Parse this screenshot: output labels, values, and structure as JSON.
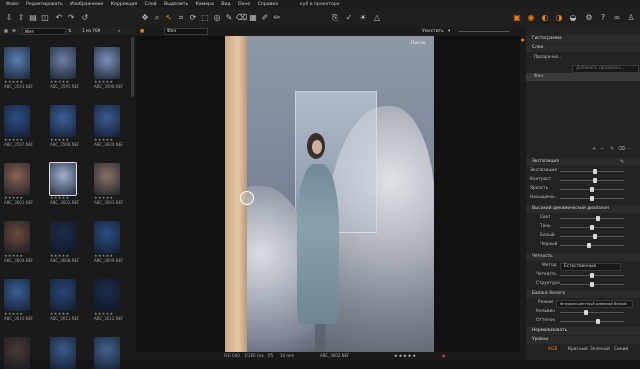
{
  "menubar": {
    "items": [
      "Файл",
      "Редактировать",
      "Изображение",
      "Коррекция",
      "Слой",
      "Выделить",
      "Камера",
      "Вид",
      "Окно",
      "Справка"
    ],
    "app_title": "ку6 в проекторе"
  },
  "browser": {
    "sort_label": "Имя",
    "count_label": "1 из 709",
    "thumbnails": [
      {
        "name": "ABC_3593.NEF",
        "stars": "★★★★★",
        "color": "#5a7fb0",
        "selected": false
      },
      {
        "name": "ABC_3595.NEF",
        "stars": "★★★★★",
        "color": "#6d80a8",
        "selected": false
      },
      {
        "name": "ABC_3596.NEF",
        "stars": "★★★★★",
        "color": "#7a8fb8",
        "selected": false
      },
      {
        "name": "ABC_3597.NEF",
        "stars": "★★★★★",
        "color": "#2e4e86",
        "selected": false
      },
      {
        "name": "ABC_3598.NEF",
        "stars": "★★★★★",
        "color": "#3c5f99",
        "selected": false
      },
      {
        "name": "ABC_3600.NEF",
        "stars": "★★★★★",
        "color": "#3a5a92",
        "selected": false
      },
      {
        "name": "ABC_3601.NEF",
        "stars": "★★★★★",
        "color": "#8a6450",
        "selected": false
      },
      {
        "name": "ABC_3602.NEF",
        "stars": "★★★★★",
        "color": "#9fb2cf",
        "selected": true
      },
      {
        "name": "ABC_3603.NEF",
        "stars": "★★★★★",
        "color": "#8a7266",
        "selected": false
      },
      {
        "name": "ABC_3604.NEF",
        "stars": "★★★★★",
        "color": "#6a4a3c",
        "selected": false
      },
      {
        "name": "ABC_3608.NEF",
        "stars": "★★★★★",
        "color": "#1e2c4a",
        "selected": false
      },
      {
        "name": "ABC_3609.NEF",
        "stars": "★★★★★",
        "color": "#2a4f84",
        "selected": false
      },
      {
        "name": "ABC_3610.NEF",
        "stars": "★★★★★",
        "color": "#3a5f94",
        "selected": false
      },
      {
        "name": "ABC_3611.NEF",
        "stars": "★★★★★",
        "color": "#2a4676",
        "selected": false
      },
      {
        "name": "ABC_3612.NEF",
        "stars": "★★★★★",
        "color": "#1c2c4c",
        "selected": false
      },
      {
        "name": "",
        "stars": "",
        "color": "#4a3a34",
        "selected": false
      },
      {
        "name": "",
        "stars": "",
        "color": "#3c5b8a",
        "selected": false
      },
      {
        "name": "",
        "stars": "",
        "color": "#43638f",
        "selected": false
      }
    ]
  },
  "viewer": {
    "header_label": "Фон",
    "zoom_label": "Уместить",
    "after_label": "После",
    "footer": {
      "iso": "ISO 640",
      "shutter": "1/160 сек",
      "aperture": "f/5",
      "focal": "34 mm",
      "filename": "ABC_3602.NEF",
      "stars": "★★★★★"
    }
  },
  "panel": {
    "histogram_title": "Гистограмма",
    "layers_title": "Слои",
    "layer_opacity_label": "Прозрачно...",
    "new_adjust_label": "Добавить прозрачн...",
    "background_layer": "Фон",
    "clarity_title": "Высокий динамический диапазон",
    "exposure_title": "Экспозиция",
    "exposure_rows": [
      {
        "label": "Экспозиция",
        "value": 0.55
      },
      {
        "label": "Контраст",
        "value": 0.55
      },
      {
        "label": "Яркость",
        "value": 0.5
      },
      {
        "label": "Насыщени...",
        "value": 0.5
      }
    ],
    "hdr_rows": [
      {
        "label": "Свет",
        "value": 0.6
      },
      {
        "label": "Тень",
        "value": 0.5
      },
      {
        "label": "Белый",
        "value": 0.55
      },
      {
        "label": "Черный",
        "value": 0.45
      }
    ],
    "clarity_section_title": "Четкость",
    "clarity_method_label": "Метод",
    "clarity_method_value": "Естественный",
    "clarity_rows": [
      {
        "label": "Четкость",
        "value": 0.5
      },
      {
        "label": "Структура",
        "value": 0.5
      }
    ],
    "wb_title": "Баланс белого",
    "wb_mode_label": "Режим",
    "wb_mode_value": "Флуоресцентный дневной белый",
    "wb_rows": [
      {
        "label": "Кельвин",
        "value": 0.4
      },
      {
        "label": "Оттенок",
        "value": 0.6
      }
    ],
    "normalize_title": "Нормализовать",
    "levels_title": "Уровни",
    "channel_tabs": [
      "RGB",
      "Красный",
      "Зеленый",
      "Синий"
    ]
  }
}
